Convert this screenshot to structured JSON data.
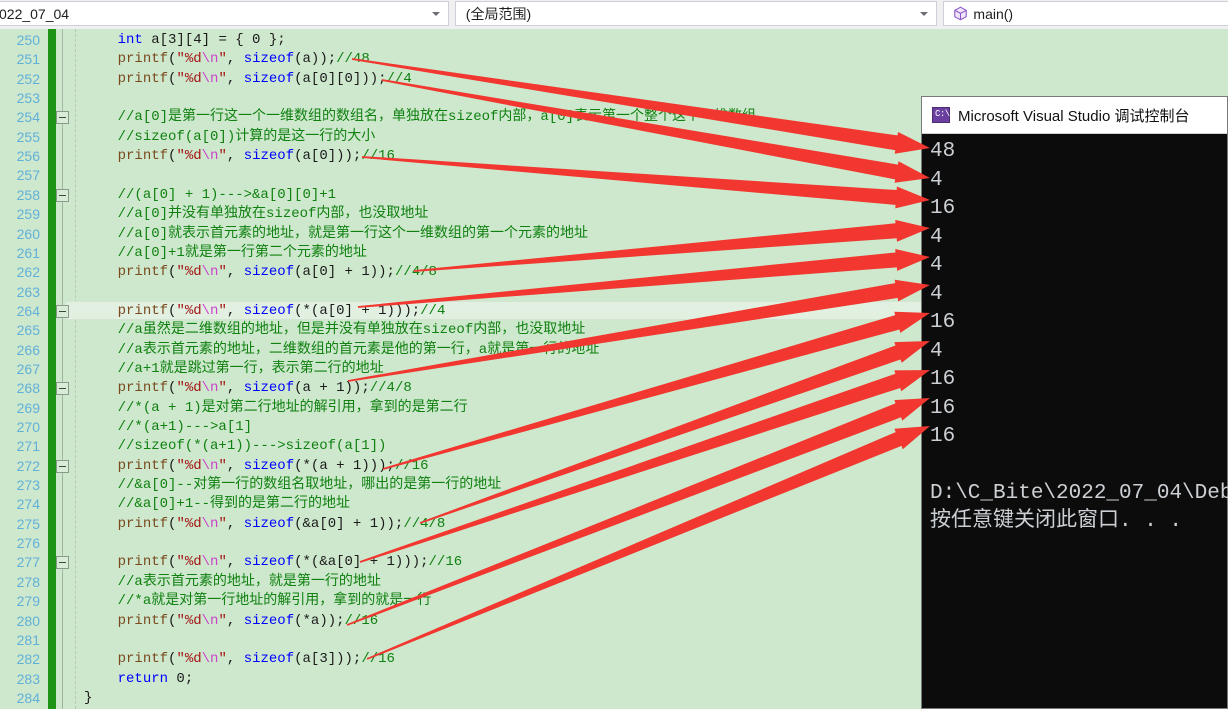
{
  "navbar": {
    "file_combo": {
      "value": "022_07_04",
      "icon": "chevron-down-icon"
    },
    "scope_combo": {
      "value": "(全局范围)",
      "icon": "chevron-down-icon"
    },
    "member_combo": {
      "value": "main()",
      "icon": "cube-icon"
    }
  },
  "editor": {
    "accent_change_bar": "#1e9416",
    "background": "#cde8cd",
    "current_line": 264,
    "lines": [
      {
        "n": 250,
        "tokens": [
          {
            "t": "    ",
            "c": "plain"
          },
          {
            "t": "int",
            "c": "kw"
          },
          {
            "t": " a[3][4] = { 0 };",
            "c": "plain"
          }
        ]
      },
      {
        "n": 251,
        "tokens": [
          {
            "t": "    ",
            "c": "plain"
          },
          {
            "t": "printf",
            "c": "fn"
          },
          {
            "t": "(",
            "c": "plain"
          },
          {
            "t": "\"%d",
            "c": "str"
          },
          {
            "t": "\\n",
            "c": "esc"
          },
          {
            "t": "\"",
            "c": "str"
          },
          {
            "t": ", ",
            "c": "plain"
          },
          {
            "t": "sizeof",
            "c": "kw"
          },
          {
            "t": "(a));",
            "c": "plain"
          },
          {
            "t": "//48",
            "c": "cmt"
          }
        ]
      },
      {
        "n": 252,
        "tokens": [
          {
            "t": "    ",
            "c": "plain"
          },
          {
            "t": "printf",
            "c": "fn"
          },
          {
            "t": "(",
            "c": "plain"
          },
          {
            "t": "\"%d",
            "c": "str"
          },
          {
            "t": "\\n",
            "c": "esc"
          },
          {
            "t": "\"",
            "c": "str"
          },
          {
            "t": ", ",
            "c": "plain"
          },
          {
            "t": "sizeof",
            "c": "kw"
          },
          {
            "t": "(a[0][0]));",
            "c": "plain"
          },
          {
            "t": "//4",
            "c": "cmt"
          }
        ]
      },
      {
        "n": 253,
        "tokens": []
      },
      {
        "n": 254,
        "tokens": [
          {
            "t": "    ",
            "c": "plain"
          },
          {
            "t": "//a[0]是第一行这一个一维数组的数组名，单独放在sizeof内部，a[0]表示第一个整个这个一维数组",
            "c": "cmt"
          }
        ]
      },
      {
        "n": 255,
        "tokens": [
          {
            "t": "    ",
            "c": "plain"
          },
          {
            "t": "//sizeof(a[0])计算的是这一行的大小",
            "c": "cmt"
          }
        ]
      },
      {
        "n": 256,
        "tokens": [
          {
            "t": "    ",
            "c": "plain"
          },
          {
            "t": "printf",
            "c": "fn"
          },
          {
            "t": "(",
            "c": "plain"
          },
          {
            "t": "\"%d",
            "c": "str"
          },
          {
            "t": "\\n",
            "c": "esc"
          },
          {
            "t": "\"",
            "c": "str"
          },
          {
            "t": ", ",
            "c": "plain"
          },
          {
            "t": "sizeof",
            "c": "kw"
          },
          {
            "t": "(a[0]));",
            "c": "plain"
          },
          {
            "t": "//16",
            "c": "cmt"
          }
        ]
      },
      {
        "n": 257,
        "tokens": []
      },
      {
        "n": 258,
        "tokens": [
          {
            "t": "    ",
            "c": "plain"
          },
          {
            "t": "//(a[0] + 1)--->&a[0][0]+1",
            "c": "cmt"
          }
        ]
      },
      {
        "n": 259,
        "tokens": [
          {
            "t": "    ",
            "c": "plain"
          },
          {
            "t": "//a[0]并没有单独放在sizeof内部，也没取地址",
            "c": "cmt"
          }
        ]
      },
      {
        "n": 260,
        "tokens": [
          {
            "t": "    ",
            "c": "plain"
          },
          {
            "t": "//a[0]就表示首元素的地址，就是第一行这个一维数组的第一个元素的地址",
            "c": "cmt"
          }
        ]
      },
      {
        "n": 261,
        "tokens": [
          {
            "t": "    ",
            "c": "plain"
          },
          {
            "t": "//a[0]+1就是第一行第二个元素的地址",
            "c": "cmt"
          }
        ]
      },
      {
        "n": 262,
        "tokens": [
          {
            "t": "    ",
            "c": "plain"
          },
          {
            "t": "printf",
            "c": "fn"
          },
          {
            "t": "(",
            "c": "plain"
          },
          {
            "t": "\"%d",
            "c": "str"
          },
          {
            "t": "\\n",
            "c": "esc"
          },
          {
            "t": "\"",
            "c": "str"
          },
          {
            "t": ", ",
            "c": "plain"
          },
          {
            "t": "sizeof",
            "c": "kw"
          },
          {
            "t": "(a[0] + 1));",
            "c": "plain"
          },
          {
            "t": "//4/8",
            "c": "cmt"
          }
        ]
      },
      {
        "n": 263,
        "tokens": []
      },
      {
        "n": 264,
        "tokens": [
          {
            "t": "    ",
            "c": "plain"
          },
          {
            "t": "printf",
            "c": "fn"
          },
          {
            "t": "(",
            "c": "plain"
          },
          {
            "t": "\"%d",
            "c": "str"
          },
          {
            "t": "\\n",
            "c": "esc"
          },
          {
            "t": "\"",
            "c": "str"
          },
          {
            "t": ", ",
            "c": "plain"
          },
          {
            "t": "sizeof",
            "c": "kw"
          },
          {
            "t": "(*(a[0] + 1)));",
            "c": "plain"
          },
          {
            "t": "//4",
            "c": "cmt"
          }
        ]
      },
      {
        "n": 265,
        "tokens": [
          {
            "t": "    ",
            "c": "plain"
          },
          {
            "t": "//a虽然是二维数组的地址，但是并没有单独放在sizeof内部，也没取地址",
            "c": "cmt"
          }
        ]
      },
      {
        "n": 266,
        "tokens": [
          {
            "t": "    ",
            "c": "plain"
          },
          {
            "t": "//a表示首元素的地址，二维数组的首元素是他的第一行，a就是第一行的地址",
            "c": "cmt"
          }
        ]
      },
      {
        "n": 267,
        "tokens": [
          {
            "t": "    ",
            "c": "plain"
          },
          {
            "t": "//a+1就是跳过第一行，表示第二行的地址",
            "c": "cmt"
          }
        ]
      },
      {
        "n": 268,
        "tokens": [
          {
            "t": "    ",
            "c": "plain"
          },
          {
            "t": "printf",
            "c": "fn"
          },
          {
            "t": "(",
            "c": "plain"
          },
          {
            "t": "\"%d",
            "c": "str"
          },
          {
            "t": "\\n",
            "c": "esc"
          },
          {
            "t": "\"",
            "c": "str"
          },
          {
            "t": ", ",
            "c": "plain"
          },
          {
            "t": "sizeof",
            "c": "kw"
          },
          {
            "t": "(a + 1));",
            "c": "plain"
          },
          {
            "t": "//4/8",
            "c": "cmt"
          }
        ]
      },
      {
        "n": 269,
        "tokens": [
          {
            "t": "    ",
            "c": "plain"
          },
          {
            "t": "//*(a + 1)是对第二行地址的解引用，拿到的是第二行",
            "c": "cmt"
          }
        ]
      },
      {
        "n": 270,
        "tokens": [
          {
            "t": "    ",
            "c": "plain"
          },
          {
            "t": "//*(a+1)--->a[1]",
            "c": "cmt"
          }
        ]
      },
      {
        "n": 271,
        "tokens": [
          {
            "t": "    ",
            "c": "plain"
          },
          {
            "t": "//sizeof(*(a+1))--->sizeof(a[1])",
            "c": "cmt"
          }
        ]
      },
      {
        "n": 272,
        "tokens": [
          {
            "t": "    ",
            "c": "plain"
          },
          {
            "t": "printf",
            "c": "fn"
          },
          {
            "t": "(",
            "c": "plain"
          },
          {
            "t": "\"%d",
            "c": "str"
          },
          {
            "t": "\\n",
            "c": "esc"
          },
          {
            "t": "\"",
            "c": "str"
          },
          {
            "t": ", ",
            "c": "plain"
          },
          {
            "t": "sizeof",
            "c": "kw"
          },
          {
            "t": "(*(a + 1)));",
            "c": "plain"
          },
          {
            "t": "//16",
            "c": "cmt"
          }
        ]
      },
      {
        "n": 273,
        "tokens": [
          {
            "t": "    ",
            "c": "plain"
          },
          {
            "t": "//&a[0]--对第一行的数组名取地址，哪出的是第一行的地址",
            "c": "cmt"
          }
        ]
      },
      {
        "n": 274,
        "tokens": [
          {
            "t": "    ",
            "c": "plain"
          },
          {
            "t": "//&a[0]+1--得到的是第二行的地址",
            "c": "cmt"
          }
        ]
      },
      {
        "n": 275,
        "tokens": [
          {
            "t": "    ",
            "c": "plain"
          },
          {
            "t": "printf",
            "c": "fn"
          },
          {
            "t": "(",
            "c": "plain"
          },
          {
            "t": "\"%d",
            "c": "str"
          },
          {
            "t": "\\n",
            "c": "esc"
          },
          {
            "t": "\"",
            "c": "str"
          },
          {
            "t": ", ",
            "c": "plain"
          },
          {
            "t": "sizeof",
            "c": "kw"
          },
          {
            "t": "(&a[0] + 1));",
            "c": "plain"
          },
          {
            "t": "//4/8",
            "c": "cmt"
          }
        ]
      },
      {
        "n": 276,
        "tokens": []
      },
      {
        "n": 277,
        "tokens": [
          {
            "t": "    ",
            "c": "plain"
          },
          {
            "t": "printf",
            "c": "fn"
          },
          {
            "t": "(",
            "c": "plain"
          },
          {
            "t": "\"%d",
            "c": "str"
          },
          {
            "t": "\\n",
            "c": "esc"
          },
          {
            "t": "\"",
            "c": "str"
          },
          {
            "t": ", ",
            "c": "plain"
          },
          {
            "t": "sizeof",
            "c": "kw"
          },
          {
            "t": "(*(&a[0] + 1)));",
            "c": "plain"
          },
          {
            "t": "//16",
            "c": "cmt"
          }
        ]
      },
      {
        "n": 278,
        "tokens": [
          {
            "t": "    ",
            "c": "plain"
          },
          {
            "t": "//a表示首元素的地址，就是第一行的地址",
            "c": "cmt"
          }
        ]
      },
      {
        "n": 279,
        "tokens": [
          {
            "t": "    ",
            "c": "plain"
          },
          {
            "t": "//*a就是对第一行地址的解引用，拿到的就是一行",
            "c": "cmt"
          }
        ]
      },
      {
        "n": 280,
        "tokens": [
          {
            "t": "    ",
            "c": "plain"
          },
          {
            "t": "printf",
            "c": "fn"
          },
          {
            "t": "(",
            "c": "plain"
          },
          {
            "t": "\"%d",
            "c": "str"
          },
          {
            "t": "\\n",
            "c": "esc"
          },
          {
            "t": "\"",
            "c": "str"
          },
          {
            "t": ", ",
            "c": "plain"
          },
          {
            "t": "sizeof",
            "c": "kw"
          },
          {
            "t": "(*a));",
            "c": "plain"
          },
          {
            "t": "//16",
            "c": "cmt"
          }
        ]
      },
      {
        "n": 281,
        "tokens": []
      },
      {
        "n": 282,
        "tokens": [
          {
            "t": "    ",
            "c": "plain"
          },
          {
            "t": "printf",
            "c": "fn"
          },
          {
            "t": "(",
            "c": "plain"
          },
          {
            "t": "\"%d",
            "c": "str"
          },
          {
            "t": "\\n",
            "c": "esc"
          },
          {
            "t": "\"",
            "c": "str"
          },
          {
            "t": ", ",
            "c": "plain"
          },
          {
            "t": "sizeof",
            "c": "kw"
          },
          {
            "t": "(a[3]));",
            "c": "plain"
          },
          {
            "t": "//16",
            "c": "cmt"
          }
        ]
      },
      {
        "n": 283,
        "tokens": [
          {
            "t": "    ",
            "c": "plain"
          },
          {
            "t": "return",
            "c": "kw"
          },
          {
            "t": " 0;",
            "c": "plain"
          }
        ]
      },
      {
        "n": 284,
        "tokens": [
          {
            "t": "}",
            "c": "plain"
          }
        ]
      }
    ],
    "fold_boxes": [
      254,
      258,
      264,
      268,
      272,
      277
    ]
  },
  "console": {
    "title": "Microsoft Visual Studio 调试控制台",
    "icon": "command-prompt-icon",
    "output": [
      "48",
      "4",
      "16",
      "4",
      "4",
      "4",
      "16",
      "4",
      "16",
      "16",
      "16"
    ],
    "path_line": "D:\\C_Bite\\2022_07_04\\Deb",
    "prompt_line": "按任意键关闭此窗口. . ."
  },
  "annotations": {
    "arrow_color": "#f1372f",
    "count": 11
  }
}
